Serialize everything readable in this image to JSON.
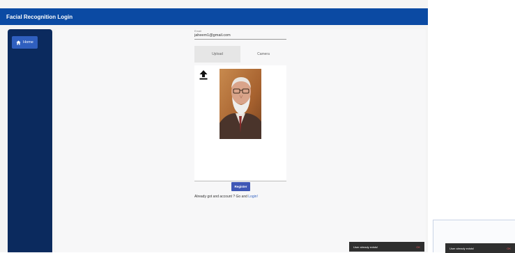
{
  "header": {
    "title": "Facial Recognition Login"
  },
  "sidebar": {
    "home_label": "Home"
  },
  "form": {
    "email_label": "Email",
    "email_value": "jaheem1@gmail.com",
    "tabs": [
      {
        "label": "Upload",
        "active": true
      },
      {
        "label": "Camera",
        "active": false
      }
    ],
    "register_label": "Register",
    "account_prefix": "Already got and account ? Go and ",
    "login_link": "Login!"
  },
  "toasts": [
    {
      "message": "User already exists!",
      "action": "OK"
    },
    {
      "message": "User already exists!",
      "action": "OK"
    }
  ],
  "colors": {
    "topbar": "#0b4aa3",
    "sidebar": "#0b2a5e",
    "accent_button": "#3f57b5",
    "toast_bg": "#2f2f2f"
  },
  "icons": {
    "home": "home-icon",
    "upload": "upload-icon"
  }
}
